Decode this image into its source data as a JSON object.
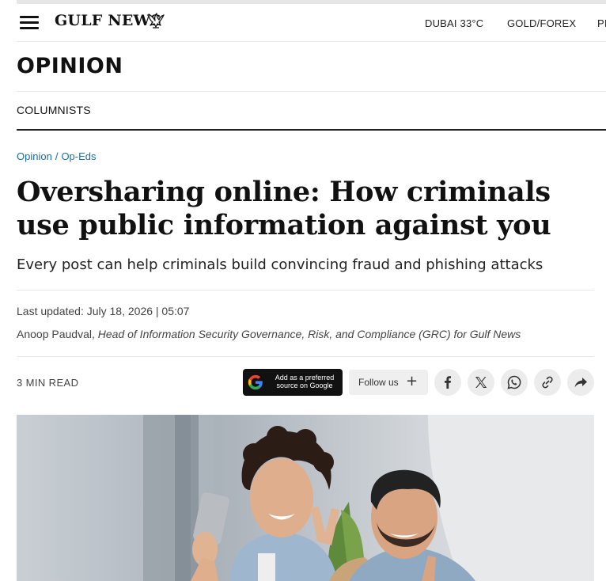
{
  "header": {
    "logo": "GULF NEWS",
    "nav": [
      "DUBAI 33°C",
      "GOLD/FOREX",
      "PI"
    ]
  },
  "section": {
    "title": "OPINION",
    "sub_nav": "COLUMNISTS"
  },
  "breadcrumb": [
    "Opinion",
    "Op-Eds"
  ],
  "breadcrumb_separator": "/",
  "article": {
    "headline_line1": "Oversharing online: How criminals",
    "headline_line2": "use public information against you",
    "subheadline": "Every post can help criminals build convincing fraud and phishing attacks",
    "last_updated": "Last updated: July 18, 2026 | 05:07",
    "author": "Anoop Paudval,",
    "author_role": "Head of Information Security Governance, Risk, and Compliance (GRC) for Gulf News",
    "read_time": "3 MIN READ"
  },
  "actions": {
    "google_line1": "Add as a preferred",
    "google_line2": "source on Google",
    "follow_label": "Follow us",
    "follow_plus": "+",
    "share_icons": [
      "facebook-icon",
      "x-icon",
      "whatsapp-icon",
      "link-icon",
      "share-arrow-icon"
    ]
  },
  "hero_image": {
    "description": "photo"
  }
}
